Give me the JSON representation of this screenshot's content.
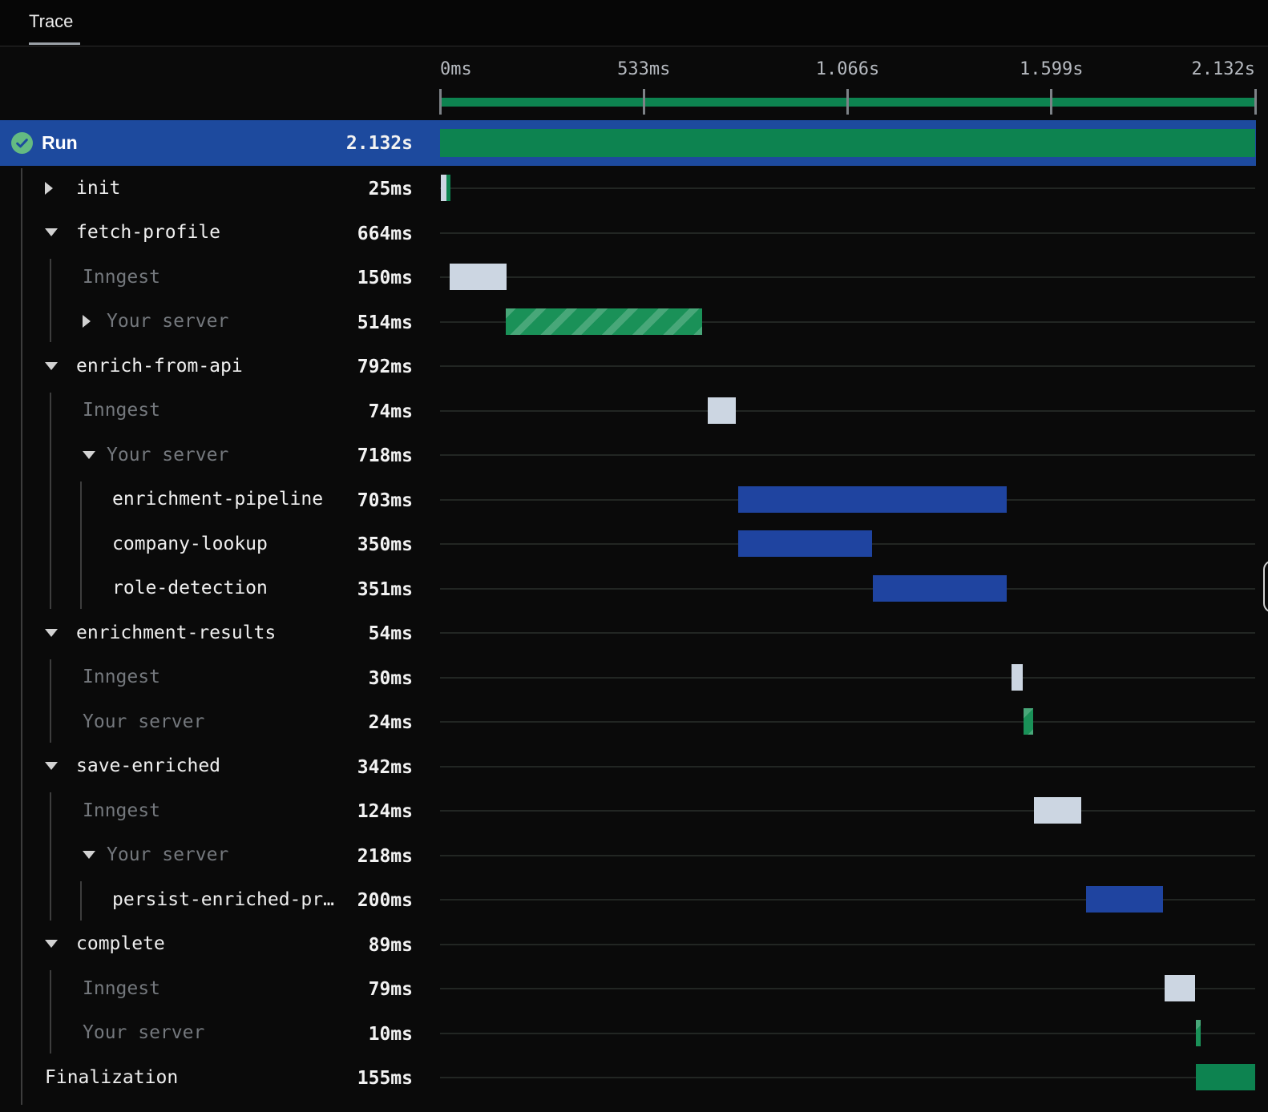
{
  "header": {
    "tab": "Trace"
  },
  "run": {
    "label": "Run",
    "duration": "2.132s",
    "status": "completed"
  },
  "timeline": {
    "total_ms": 2132,
    "ticks": [
      {
        "label": "0ms",
        "ms": 0
      },
      {
        "label": "533ms",
        "ms": 533
      },
      {
        "label": "1.066s",
        "ms": 1066
      },
      {
        "label": "1.599s",
        "ms": 1599
      },
      {
        "label": "2.132s",
        "ms": 2132
      }
    ]
  },
  "colors": {
    "row_selected_blue": "#1d4a9e",
    "bar_blue": "#1f44a0",
    "bar_green": "#0d8350",
    "bar_hatch_green": "#1a9158",
    "bar_gray": "#ccd6e2"
  },
  "rows": [
    {
      "name": "init",
      "duration": "25ms",
      "depth": 0,
      "arrow": "collapsed",
      "dim": false,
      "bars": [
        {
          "type": "queue",
          "start": 2,
          "end": 16
        },
        {
          "type": "run",
          "start": 16,
          "end": 27
        }
      ]
    },
    {
      "name": "fetch-profile",
      "duration": "664ms",
      "depth": 0,
      "arrow": "expanded",
      "dim": false,
      "bars": []
    },
    {
      "name": "Inngest",
      "duration": "150ms",
      "depth": 1,
      "arrow": null,
      "dim": true,
      "bars": [
        {
          "type": "queue",
          "start": 25,
          "end": 175
        }
      ]
    },
    {
      "name": "Your server",
      "duration": "514ms",
      "depth": 1,
      "arrow": "collapsed",
      "dim": true,
      "bars": [
        {
          "type": "server",
          "start": 172,
          "end": 686
        }
      ]
    },
    {
      "name": "enrich-from-api",
      "duration": "792ms",
      "depth": 0,
      "arrow": "expanded",
      "dim": false,
      "bars": []
    },
    {
      "name": "Inngest",
      "duration": "74ms",
      "depth": 1,
      "arrow": null,
      "dim": true,
      "bars": [
        {
          "type": "queue",
          "start": 700,
          "end": 774
        }
      ]
    },
    {
      "name": "Your server",
      "duration": "718ms",
      "depth": 1,
      "arrow": "expanded",
      "dim": true,
      "bars": []
    },
    {
      "name": "enrichment-pipeline",
      "duration": "703ms",
      "depth": 2,
      "arrow": null,
      "dim": false,
      "bars": [
        {
          "type": "step",
          "start": 780,
          "end": 1483
        }
      ]
    },
    {
      "name": "company-lookup",
      "duration": "350ms",
      "depth": 2,
      "arrow": null,
      "dim": false,
      "bars": [
        {
          "type": "step",
          "start": 780,
          "end": 1130
        }
      ]
    },
    {
      "name": "role-detection",
      "duration": "351ms",
      "depth": 2,
      "arrow": null,
      "dim": false,
      "bars": [
        {
          "type": "step",
          "start": 1132,
          "end": 1483
        }
      ]
    },
    {
      "name": "enrichment-results",
      "duration": "54ms",
      "depth": 0,
      "arrow": "expanded",
      "dim": false,
      "bars": []
    },
    {
      "name": "Inngest",
      "duration": "30ms",
      "depth": 1,
      "arrow": null,
      "dim": true,
      "bars": [
        {
          "type": "queue",
          "start": 1495,
          "end": 1525
        }
      ]
    },
    {
      "name": "Your server",
      "duration": "24ms",
      "depth": 1,
      "arrow": null,
      "dim": true,
      "bars": [
        {
          "type": "server",
          "start": 1527,
          "end": 1551
        }
      ]
    },
    {
      "name": "save-enriched",
      "duration": "342ms",
      "depth": 0,
      "arrow": "expanded",
      "dim": false,
      "bars": []
    },
    {
      "name": "Inngest",
      "duration": "124ms",
      "depth": 1,
      "arrow": null,
      "dim": true,
      "bars": [
        {
          "type": "queue",
          "start": 1553,
          "end": 1677
        }
      ]
    },
    {
      "name": "Your server",
      "duration": "218ms",
      "depth": 1,
      "arrow": "expanded",
      "dim": true,
      "bars": []
    },
    {
      "name": "persist-enriched-pr…",
      "duration": "200ms",
      "depth": 2,
      "arrow": null,
      "dim": false,
      "bars": [
        {
          "type": "step",
          "start": 1690,
          "end": 1890
        }
      ]
    },
    {
      "name": "complete",
      "duration": "89ms",
      "depth": 0,
      "arrow": "expanded",
      "dim": false,
      "bars": []
    },
    {
      "name": "Inngest",
      "duration": "79ms",
      "depth": 1,
      "arrow": null,
      "dim": true,
      "bars": [
        {
          "type": "queue",
          "start": 1895,
          "end": 1974
        }
      ]
    },
    {
      "name": "Your server",
      "duration": "10ms",
      "depth": 1,
      "arrow": null,
      "dim": true,
      "bars": [
        {
          "type": "server",
          "start": 1977,
          "end": 1989
        }
      ]
    },
    {
      "name": "Finalization",
      "duration": "155ms",
      "depth": 0,
      "arrow": null,
      "dim": false,
      "bars": [
        {
          "type": "run",
          "start": 1977,
          "end": 2132
        }
      ]
    }
  ]
}
